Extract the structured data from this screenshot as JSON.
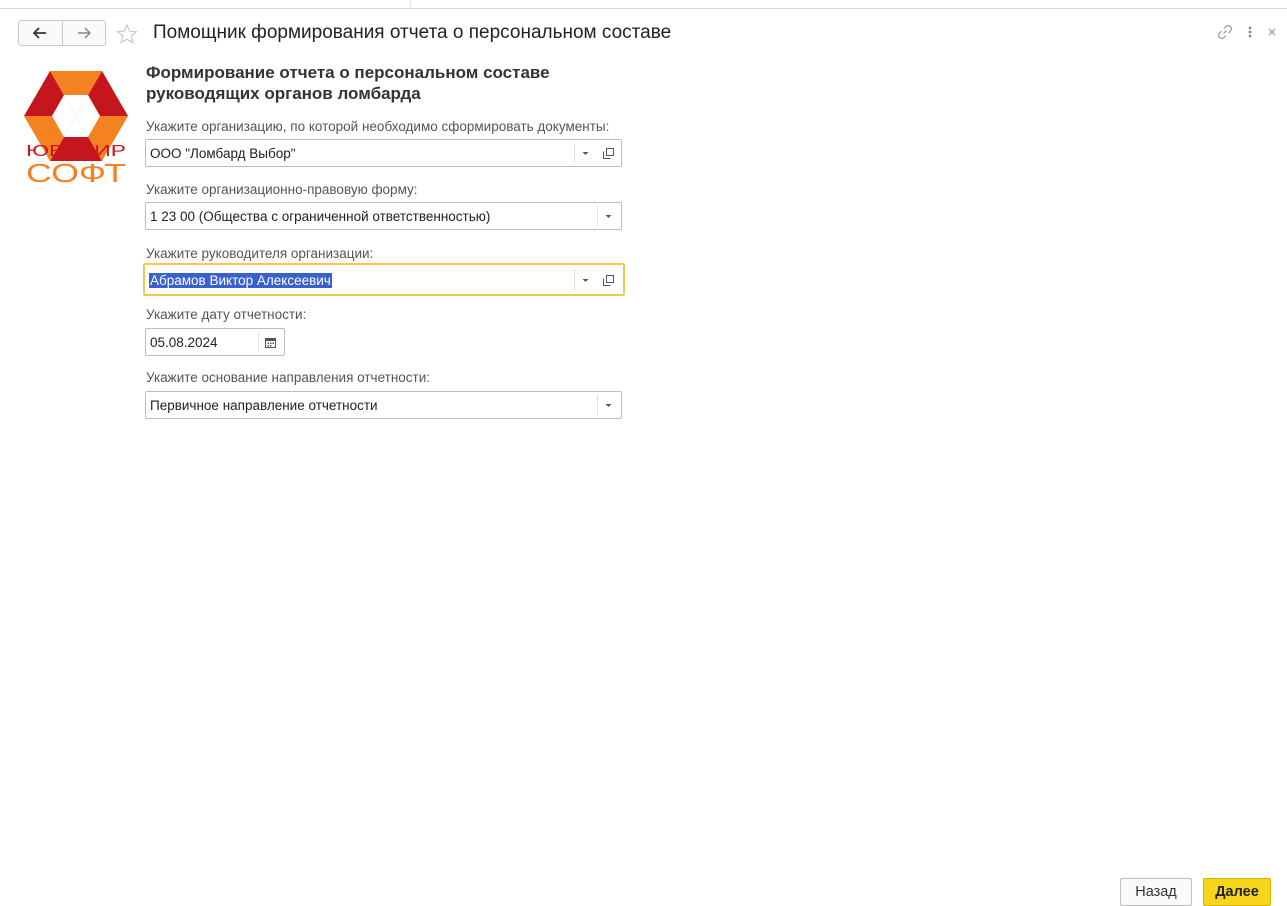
{
  "window": {
    "title": "Помощник формирования отчета о персональном составе",
    "icons": [
      "back-arrow-icon",
      "forward-arrow-icon",
      "favorite-star-icon",
      "link-icon",
      "more-menu-icon",
      "close-icon"
    ]
  },
  "logo": {
    "text_top": "ЮВЕЛИР",
    "text_bottom": "СОФТ",
    "colors": {
      "red": "#c4161c",
      "orange": "#f58220"
    }
  },
  "form": {
    "heading": "Формирование отчета о персональном составе руководящих органов ломбарда",
    "organization": {
      "label": "Укажите организацию, по которой необходимо сформировать документы:",
      "value": "ООО \"Ломбард Выбор\""
    },
    "legal_form": {
      "label": "Укажите организационно-правовую форму:",
      "value": "1 23 00 (Общества с ограниченной ответственностью)"
    },
    "director": {
      "label": "Укажите руководителя организации:",
      "value": "Абрамов Виктор Алексеевич"
    },
    "report_date": {
      "label": "Укажите дату отчетности:",
      "value": "05.08.2024"
    },
    "basis": {
      "label": "Укажите основание направления отчетности:",
      "value": "Первичное направление отчетности"
    }
  },
  "footer": {
    "back_label": "Назад",
    "next_label": "Далее"
  },
  "colors": {
    "accent_yellow": "#f7d51d",
    "focus_border": "#f2c94c",
    "selection": "#3960cf"
  }
}
